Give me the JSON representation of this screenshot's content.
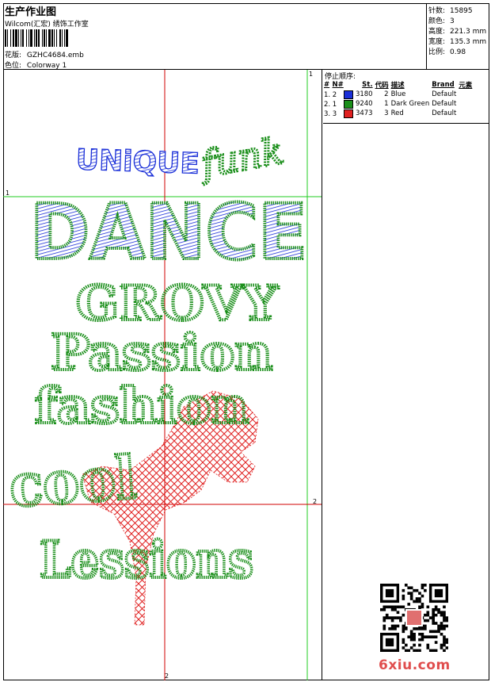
{
  "header": {
    "title": "生产作业图",
    "company": "Wilcom(汇宏) 绣饰工作室",
    "design_label": "花版:",
    "design_value": "GZHC4684.emb",
    "colorway_label": "色位:",
    "colorway_value": "Colorway 1"
  },
  "stats": [
    {
      "label": "针数:",
      "value": "15895"
    },
    {
      "label": "颜色:",
      "value": "3"
    },
    {
      "label": "高度:",
      "value": "221.3 mm"
    },
    {
      "label": "宽度:",
      "value": "135.3 mm"
    },
    {
      "label": "比例:",
      "value": "0.98"
    }
  ],
  "stop_sequence": {
    "caption": "停止顺序:",
    "headers": [
      "#",
      "N#",
      "St.",
      "代码",
      "描述",
      "Brand",
      "元素"
    ],
    "rows": [
      {
        "index": "1. 2",
        "color": "#1a2fd8",
        "st": "3180",
        "code": "2",
        "desc": "Blue",
        "brand": "Default"
      },
      {
        "index": "2. 1",
        "color": "#1b8f1b",
        "st": "9240",
        "code": "1",
        "desc": "Dark Green",
        "brand": "Default"
      },
      {
        "index": "3. 3",
        "color": "#e02020",
        "st": "3473",
        "code": "3",
        "desc": "Red",
        "brand": "Default"
      }
    ]
  },
  "design": {
    "text_unique": "UNiQUE",
    "text_funk": "funk",
    "text_dance": "DANCE",
    "text_groovy": "GROVY",
    "text_passion": "Passion",
    "text_fashion": "fashion",
    "text_cool": "cool",
    "text_lessions": "Lessions",
    "guide_v1": "1",
    "guide_h1": "1",
    "guide_h2": "2",
    "guide_v2": "2",
    "colors": {
      "blue": "#1a2fd8",
      "green": "#1b8f1b",
      "red": "#e02020",
      "guide_red": "#d00000",
      "guide_green": "#22cc22"
    }
  },
  "watermark": "6xiu.com"
}
